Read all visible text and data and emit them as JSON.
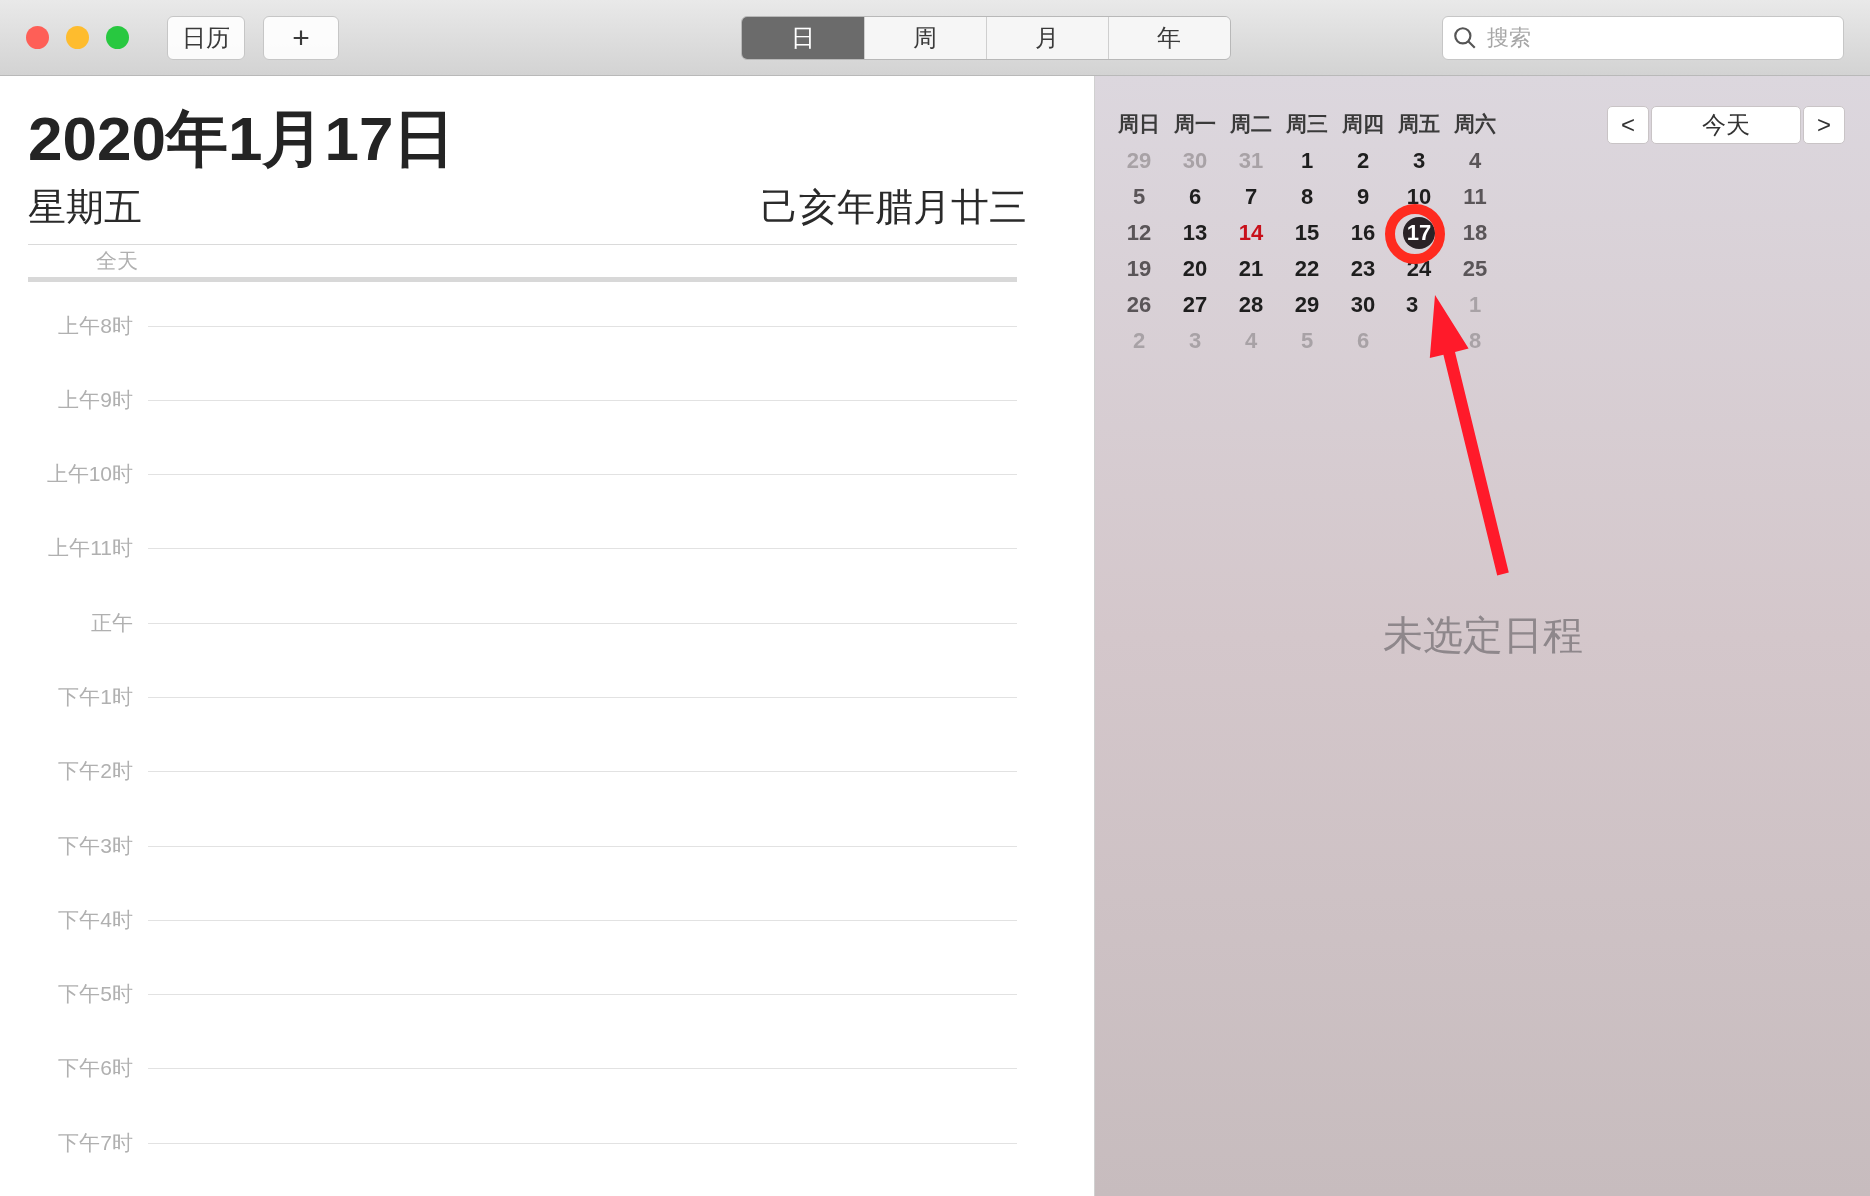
{
  "window": {
    "controls": [
      {
        "color": "#fe5f57"
      },
      {
        "color": "#febc2e"
      },
      {
        "color": "#28c840"
      }
    ]
  },
  "toolbar": {
    "calendars_button": "日历",
    "add_button": "+",
    "view_tabs": [
      {
        "label": "日",
        "selected": true
      },
      {
        "label": "周",
        "selected": false
      },
      {
        "label": "月",
        "selected": false
      },
      {
        "label": "年",
        "selected": false
      }
    ],
    "search": {
      "placeholder": "搜索"
    }
  },
  "day_view": {
    "date": "2020年1月17日",
    "weekday": "星期五",
    "lunar_date": "己亥年腊月廿三",
    "all_day_label": "全天",
    "hours": [
      "上午8时",
      "上午9时",
      "上午10时",
      "上午11时",
      "正午",
      "下午1时",
      "下午2时",
      "下午3时",
      "下午4时",
      "下午5时",
      "下午6时",
      "下午7时"
    ]
  },
  "mini_calendar": {
    "weekdays": [
      "周日",
      "周一",
      "周二",
      "周三",
      "周四",
      "周五",
      "周六"
    ],
    "prev_button": "<",
    "today_button": "今天",
    "next_button": ">",
    "weeks": [
      [
        {
          "label": "29",
          "kind": "other",
          "selected": false
        },
        {
          "label": "30",
          "kind": "other",
          "selected": false
        },
        {
          "label": "31",
          "kind": "other",
          "selected": false
        },
        {
          "label": "1",
          "kind": "day",
          "selected": false
        },
        {
          "label": "2",
          "kind": "day",
          "selected": false
        },
        {
          "label": "3",
          "kind": "day",
          "selected": false
        },
        {
          "label": "4",
          "kind": "weekend",
          "selected": false
        }
      ],
      [
        {
          "label": "5",
          "kind": "weekend",
          "selected": false
        },
        {
          "label": "6",
          "kind": "day",
          "selected": false
        },
        {
          "label": "7",
          "kind": "day",
          "selected": false
        },
        {
          "label": "8",
          "kind": "day",
          "selected": false
        },
        {
          "label": "9",
          "kind": "day",
          "selected": false
        },
        {
          "label": "10",
          "kind": "day",
          "selected": false
        },
        {
          "label": "11",
          "kind": "weekend",
          "selected": false
        }
      ],
      [
        {
          "label": "12",
          "kind": "weekend",
          "selected": false
        },
        {
          "label": "13",
          "kind": "day",
          "selected": false
        },
        {
          "label": "14",
          "kind": "holiday",
          "selected": false
        },
        {
          "label": "15",
          "kind": "day",
          "selected": false
        },
        {
          "label": "16",
          "kind": "day",
          "selected": false
        },
        {
          "label": "17",
          "kind": "day",
          "selected": true
        },
        {
          "label": "18",
          "kind": "weekend",
          "selected": false
        }
      ],
      [
        {
          "label": "19",
          "kind": "weekend",
          "selected": false
        },
        {
          "label": "20",
          "kind": "day",
          "selected": false
        },
        {
          "label": "21",
          "kind": "day",
          "selected": false
        },
        {
          "label": "22",
          "kind": "day",
          "selected": false
        },
        {
          "label": "23",
          "kind": "day",
          "selected": false
        },
        {
          "label": "24",
          "kind": "day",
          "selected": false
        },
        {
          "label": "25",
          "kind": "weekend",
          "selected": false
        }
      ],
      [
        {
          "label": "26",
          "kind": "weekend",
          "selected": false
        },
        {
          "label": "27",
          "kind": "day",
          "selected": false
        },
        {
          "label": "28",
          "kind": "day",
          "selected": false
        },
        {
          "label": "29",
          "kind": "day",
          "selected": false
        },
        {
          "label": "30",
          "kind": "day",
          "selected": false
        },
        {
          "label": "3",
          "kind": "cut",
          "selected": false
        },
        {
          "label": "1",
          "kind": "other",
          "selected": false
        }
      ],
      [
        {
          "label": "2",
          "kind": "other",
          "selected": false
        },
        {
          "label": "3",
          "kind": "other",
          "selected": false
        },
        {
          "label": "4",
          "kind": "other",
          "selected": false
        },
        {
          "label": "5",
          "kind": "other",
          "selected": false
        },
        {
          "label": "6",
          "kind": "other",
          "selected": false
        },
        {
          "kind": "hidden"
        },
        {
          "label": "8",
          "kind": "other",
          "selected": false
        }
      ]
    ]
  },
  "detail": {
    "empty_message": "未选定日程"
  }
}
